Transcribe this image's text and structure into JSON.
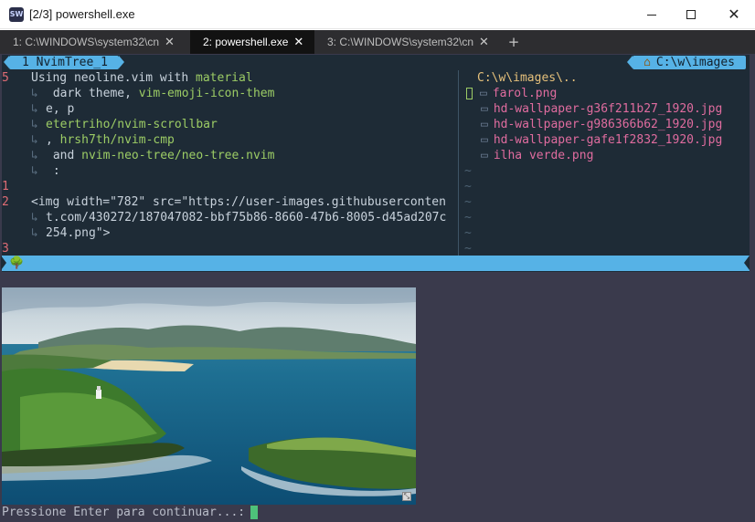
{
  "window": {
    "icon_text": "SW",
    "title": "[2/3] powershell.exe",
    "minimize_glyph": "",
    "maximize_glyph": "",
    "close_glyph": "✕"
  },
  "tabs": [
    {
      "label": "1: C:\\WINDOWS\\system32\\cn",
      "close": "✕",
      "active": false
    },
    {
      "label": "2: powershell.exe",
      "close": "✕",
      "active": true
    },
    {
      "label": "3: C:\\WINDOWS\\system32\\cn",
      "close": "✕",
      "active": false
    }
  ],
  "new_tab": "+",
  "vim": {
    "tabline_left": "1 NvimTree_1",
    "tabline_right": "C:\\w\\images",
    "home_icon": "home-icon",
    "buffer_lines": [
      {
        "nr": "5",
        "text": "Using neoline.vim with ",
        "hl": "material"
      },
      {
        "nr": "",
        "wrap": "↳",
        "text": " dark theme, ",
        "hl": "vim-emoji-icon-them"
      },
      {
        "nr": "",
        "wrap": "↳",
        "text": "e, p",
        "hl": ""
      },
      {
        "nr": "",
        "wrap": "↳",
        "text": "",
        "hl": "etertriho/nvim-scrollbar"
      },
      {
        "nr": "",
        "wrap": "↳",
        "text": ", ",
        "hl": "hrsh7th/nvim-cmp"
      },
      {
        "nr": "",
        "wrap": "↳",
        "text": " and ",
        "hl": "nvim-neo-tree/neo-tree.nvim"
      },
      {
        "nr": "",
        "wrap": "↳",
        "text": " :",
        "hl": ""
      },
      {
        "nr": "1",
        "text": "",
        "hl": ""
      },
      {
        "nr": "2",
        "text": "<img width=\"782\" src=\"https://user-images.githubuserconten",
        "hl": ""
      },
      {
        "nr": "",
        "wrap": "↳",
        "text": "t.com/430272/187047082-bbf75b86-8660-47b6-8005-d45ad207c",
        "hl": ""
      },
      {
        "nr": "",
        "wrap": "↳",
        "text": "254.png\">",
        "hl": ""
      },
      {
        "nr": "3",
        "text": "",
        "hl": ""
      }
    ],
    "tree": {
      "root": "C:\\w\\images\\..",
      "files": [
        "farol.png",
        "hd-wallpaper-g36f211b27_1920.jpg",
        "hd-wallpaper-g986366b62_1920.jpg",
        "hd-wallpaper-gafe1f2832_1920.jpg",
        "ilha verde.png"
      ],
      "filler": "~"
    },
    "status_icon": "tree-icon"
  },
  "prompt": "Pressione Enter para continuar...:",
  "colors": {
    "terminal_bg": "#3a3a4c",
    "vim_bg": "#1e2b36",
    "accent": "#56b2e6",
    "line_number": "#e06c75",
    "highlight": "#9ccc65",
    "tree_file": "#e06c9f",
    "tree_root": "#e5c07b"
  }
}
